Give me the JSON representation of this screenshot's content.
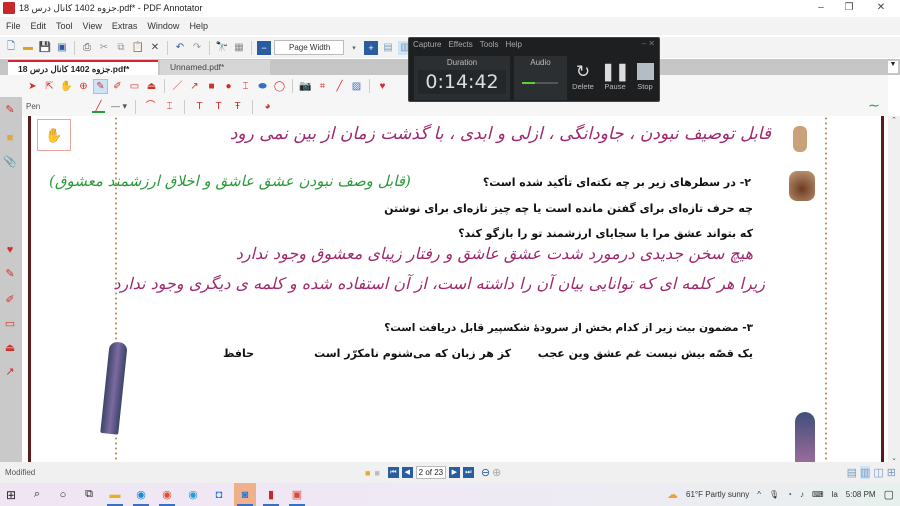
{
  "window": {
    "title": "جزوه 1402 کانال درس 18.pdf* - PDF Annotator",
    "minimize": "–",
    "maximize": "❐",
    "close": "✕"
  },
  "menu": [
    "File",
    "Edit",
    "Tool",
    "View",
    "Extras",
    "Window",
    "Help"
  ],
  "toolbar": {
    "zoom_value": "Page Width"
  },
  "tabs": [
    {
      "label": "جزوه 1402 کانال درس 18.pdf*",
      "active": true
    },
    {
      "label": "Unnamed.pdf*",
      "active": false
    }
  ],
  "annotation_toolbar": {
    "current_tool": "Pen"
  },
  "recorder": {
    "menu": [
      "Capture",
      "Effects",
      "Tools",
      "Help"
    ],
    "duration_label": "Duration",
    "duration": "0:14:42",
    "audio_label": "Audio",
    "delete": "Delete",
    "pause": "Pause",
    "stop": "Stop",
    "audio_level": 0.35
  },
  "document": {
    "q2_title": "۲- در سطرهای زیر بر چه نکته‌ای تأکید شده است؟",
    "q2_line1": "چه حرف تازه‌ای برای گفتن مانده است یا چه چیز تازه‌ای برای نوشتن",
    "q2_line2": "که بتواند عشق مرا یا سجایای ارزشمند تو را بازگو کند؟",
    "q3_title": "۳- مضمون بیت زیر از کدام بخش از سرودهٔ شکسپیر قابل دریافت است؟",
    "verse_1": "یک قصّه بیش نیست غم عشق وین عجب",
    "verse_2": "کز هر زبان که می‌شنوم نامکرّر است",
    "poet": "حافظ",
    "handwriting": {
      "answer1": "قابل توصیف نبودن ، جاودانگی ، ازلی و ابدی ، با گذشت زمان از بین نمی رود",
      "answer2_green": "(قابل وصف نبودن عشق عاشق و اخلاق ارزشمند معشوق)",
      "answer3_line1": "هیچ سخن جدیدی درمورد شدت عشق عاشق و رفتار زیبای معشوق وجود ندارد",
      "answer3_line2": "زیرا هر کلمه ای که توانایی بیان آن را داشته است، از آن استفاده شده و کلمه ی دیگری وجود ندارد"
    },
    "colors": {
      "purple_ink": "#a0286e",
      "green_ink": "#2a9a3a"
    }
  },
  "status": {
    "state": "Modified",
    "page_indicator": "2 of 23"
  },
  "taskbar": {
    "weather": "61°F  Partly sunny",
    "time": "5:08 PM",
    "lang": "la"
  }
}
